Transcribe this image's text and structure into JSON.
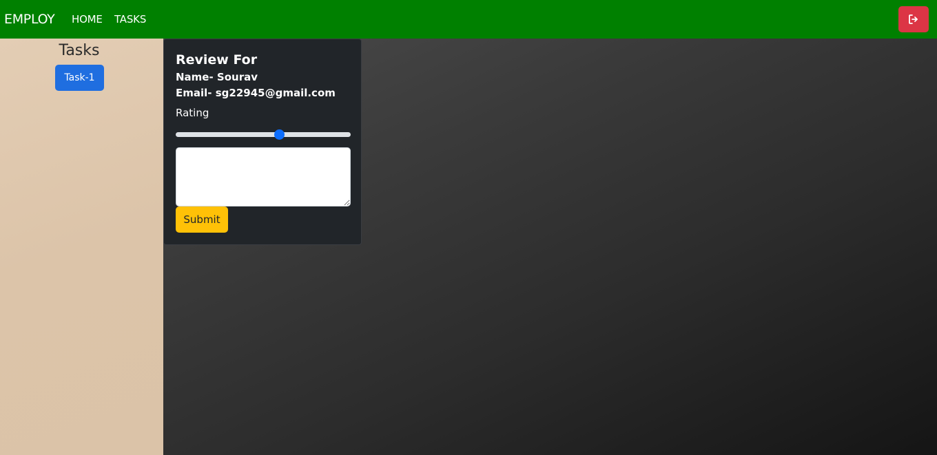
{
  "navbar": {
    "brand": "EMPLOY",
    "links": [
      {
        "label": "HOME"
      },
      {
        "label": "TASKS"
      }
    ],
    "logout_icon": "sign-out-icon",
    "color": "#008000",
    "logout_color": "#dc3545"
  },
  "sidebar": {
    "title": "Tasks",
    "tasks": [
      {
        "label": "Task-1"
      }
    ]
  },
  "review": {
    "title": "Review For",
    "name": "Name- Sourav",
    "email": "Email- sg22945@gmail.com",
    "rating_label": "Rating",
    "rating_value": 0.59,
    "comment": "",
    "submit_label": "Submit"
  }
}
